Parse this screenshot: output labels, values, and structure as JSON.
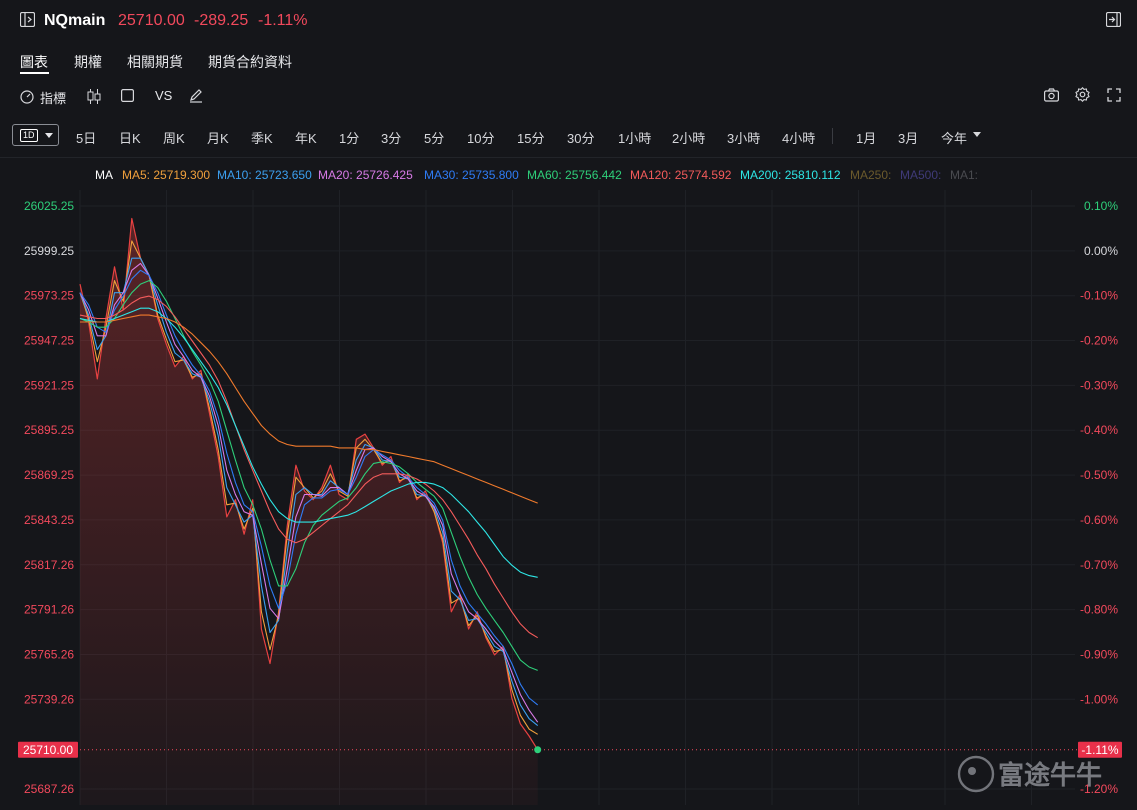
{
  "header": {
    "symbol": "NQmain",
    "price": "25710.00",
    "change": "-289.25",
    "change_pct": "-1.11%"
  },
  "tabs": [
    {
      "label": "圖表",
      "active": true
    },
    {
      "label": "期權"
    },
    {
      "label": "相關期貨"
    },
    {
      "label": "期貨合約資料"
    }
  ],
  "toolbar": {
    "indicators_label": "指標",
    "vs_label": "VS"
  },
  "timeframes": {
    "selected": "1D",
    "items": [
      "5日",
      "日K",
      "周K",
      "月K",
      "季K",
      "年K",
      "1分",
      "3分",
      "5分",
      "10分",
      "15分",
      "30分",
      "1小時",
      "2小時",
      "3小時",
      "4小時"
    ],
    "range_items": [
      "1月",
      "3月",
      "今年"
    ]
  },
  "legend": {
    "title": "MA",
    "items": [
      {
        "text": "MA5: 25719.300",
        "color": "#f0a03c"
      },
      {
        "text": "MA10: 25723.650",
        "color": "#3ca0f0"
      },
      {
        "text": "MA20: 25726.425",
        "color": "#d77ae6"
      },
      {
        "text": "MA30: 25735.800",
        "color": "#2f7cf6"
      },
      {
        "text": "MA60: 25756.442",
        "color": "#2ecf7a"
      },
      {
        "text": "MA120: 25774.592",
        "color": "#f45b5b"
      },
      {
        "text": "MA200: 25810.112",
        "color": "#2ee6e6"
      },
      {
        "text": "MA250:",
        "color": "#6b5a2c"
      },
      {
        "text": "MA500:",
        "color": "#3f3a78"
      },
      {
        "text": "MA1:",
        "color": "#4a4b50"
      }
    ]
  },
  "colors": {
    "price_line": "#e84141",
    "up": "#2ecf7a",
    "down": "#f2495c",
    "grid": "#1f2126"
  },
  "watermark": {
    "logo": "moomoo-logo",
    "text": "富途牛牛"
  },
  "chart_data": {
    "type": "line",
    "ylim": [
      25687.26,
      26025.25
    ],
    "y_ticks_left": [
      {
        "label": "26025.25",
        "value": 26025.25,
        "color": "#2ecf7a"
      },
      {
        "label": "25999.25",
        "value": 25999.25,
        "color": "#d7d8dc"
      },
      {
        "label": "25973.25",
        "value": 25973.25,
        "color": "#f2495c"
      },
      {
        "label": "25947.25",
        "value": 25947.25,
        "color": "#f2495c"
      },
      {
        "label": "25921.25",
        "value": 25921.25,
        "color": "#f2495c"
      },
      {
        "label": "25895.25",
        "value": 25895.25,
        "color": "#f2495c"
      },
      {
        "label": "25869.25",
        "value": 25869.25,
        "color": "#f2495c"
      },
      {
        "label": "25843.25",
        "value": 25843.25,
        "color": "#f2495c"
      },
      {
        "label": "25817.26",
        "value": 25817.26,
        "color": "#f2495c"
      },
      {
        "label": "25791.26",
        "value": 25791.26,
        "color": "#f2495c"
      },
      {
        "label": "25765.26",
        "value": 25765.26,
        "color": "#f2495c"
      },
      {
        "label": "25739.26",
        "value": 25739.26,
        "color": "#f2495c"
      },
      {
        "label": "25687.26",
        "value": 25687.26,
        "color": "#f2495c"
      }
    ],
    "y_ticks_right": [
      {
        "label": "0.10%",
        "value": 26025.25,
        "color": "#2ecf7a"
      },
      {
        "label": "0.00%",
        "value": 25999.25,
        "color": "#d7d8dc"
      },
      {
        "label": "-0.10%",
        "value": 25973.25,
        "color": "#f2495c"
      },
      {
        "label": "-0.20%",
        "value": 25947.25,
        "color": "#f2495c"
      },
      {
        "label": "-0.30%",
        "value": 25921.25,
        "color": "#f2495c"
      },
      {
        "label": "-0.40%",
        "value": 25895.25,
        "color": "#f2495c"
      },
      {
        "label": "-0.50%",
        "value": 25869.25,
        "color": "#f2495c"
      },
      {
        "label": "-0.60%",
        "value": 25843.25,
        "color": "#f2495c"
      },
      {
        "label": "-0.70%",
        "value": 25817.26,
        "color": "#f2495c"
      },
      {
        "label": "-0.80%",
        "value": 25791.26,
        "color": "#f2495c"
      },
      {
        "label": "-0.90%",
        "value": 25765.26,
        "color": "#f2495c"
      },
      {
        "label": "-1.00%",
        "value": 25739.26,
        "color": "#f2495c"
      },
      {
        "label": "-1.20%",
        "value": 25687.26,
        "color": "#f2495c"
      }
    ],
    "last_price": {
      "label": "25710.00",
      "pct_label": "-1.11%",
      "value": 25710.0
    },
    "session_fraction": 0.46,
    "series": [
      {
        "name": "Price",
        "color": "#e84141",
        "width": 1.2,
        "values": [
          25980,
          25958,
          25925,
          25960,
          25990,
          25965,
          26018,
          25995,
          25985,
          25960,
          25945,
          25932,
          25938,
          25925,
          25930,
          25905,
          25880,
          25845,
          25855,
          25835,
          25855,
          25780,
          25760,
          25790,
          25840,
          25875,
          25860,
          25855,
          25862,
          25875,
          25858,
          25855,
          25890,
          25893,
          25885,
          25875,
          25880,
          25865,
          25870,
          25855,
          25860,
          25848,
          25830,
          25790,
          25800,
          25780,
          25790,
          25775,
          25765,
          25770,
          25740,
          25725,
          25718,
          25710
        ]
      },
      {
        "name": "MA5",
        "color": "#f0a03c",
        "width": 1.1,
        "values": [
          25975,
          25960,
          25935,
          25955,
          25982,
          25970,
          26005,
          25995,
          25985,
          25962,
          25948,
          25935,
          25936,
          25926,
          25928,
          25908,
          25884,
          25852,
          25853,
          25838,
          25850,
          25790,
          25768,
          25788,
          25835,
          25868,
          25862,
          25856,
          25860,
          25870,
          25860,
          25857,
          25885,
          25890,
          25884,
          25876,
          25878,
          25866,
          25868,
          25856,
          25858,
          25848,
          25832,
          25795,
          25798,
          25782,
          25788,
          25776,
          25767,
          25768,
          25745,
          25730,
          25722,
          25719
        ]
      },
      {
        "name": "MA10",
        "color": "#3ca0f0",
        "width": 1.1,
        "values": [
          25975,
          25962,
          25942,
          25950,
          25975,
          25975,
          25995,
          25995,
          25985,
          25968,
          25952,
          25940,
          25936,
          25928,
          25926,
          25912,
          25892,
          25862,
          25852,
          25842,
          25846,
          25805,
          25778,
          25785,
          25825,
          25858,
          25862,
          25858,
          25858,
          25866,
          25862,
          25858,
          25878,
          25887,
          25885,
          25878,
          25877,
          25868,
          25867,
          25858,
          25857,
          25850,
          25836,
          25802,
          25797,
          25785,
          25786,
          25778,
          25770,
          25767,
          25750,
          25736,
          25728,
          25724
        ]
      },
      {
        "name": "MA20",
        "color": "#d77ae6",
        "width": 1.1,
        "values": [
          25975,
          25965,
          25950,
          25950,
          25968,
          25975,
          25988,
          25992,
          25985,
          25972,
          25958,
          25945,
          25938,
          25930,
          25926,
          25915,
          25898,
          25872,
          25858,
          25848,
          25846,
          25818,
          25792,
          25786,
          25815,
          25845,
          25858,
          25858,
          25857,
          25862,
          25862,
          25858,
          25872,
          25884,
          25885,
          25880,
          25877,
          25870,
          25867,
          25860,
          25857,
          25851,
          25840,
          25812,
          25800,
          25790,
          25786,
          25780,
          25773,
          25768,
          25755,
          25742,
          25733,
          25726
        ]
      },
      {
        "name": "MA30",
        "color": "#2f7cf6",
        "width": 1.1,
        "values": [
          25975,
          25968,
          25955,
          25952,
          25965,
          25973,
          25983,
          25988,
          25985,
          25975,
          25962,
          25950,
          25941,
          25933,
          25927,
          25918,
          25903,
          25882,
          25865,
          25852,
          25848,
          25828,
          25805,
          25792,
          25808,
          25835,
          25852,
          25856,
          25856,
          25860,
          25861,
          25858,
          25868,
          25880,
          25884,
          25881,
          25878,
          25872,
          25868,
          25862,
          25858,
          25853,
          25843,
          25820,
          25805,
          25795,
          25789,
          25783,
          25776,
          25770,
          25760,
          25748,
          25740,
          25736
        ]
      },
      {
        "name": "MA60",
        "color": "#2ecf7a",
        "width": 1.1,
        "values": [
          25960,
          25958,
          25955,
          25955,
          25960,
          25968,
          25975,
          25980,
          25982,
          25978,
          25970,
          25960,
          25950,
          25941,
          25933,
          25924,
          25912,
          25895,
          25878,
          25862,
          25852,
          25838,
          25820,
          25805,
          25805,
          25815,
          25830,
          25840,
          25846,
          25850,
          25854,
          25856,
          25862,
          25870,
          25876,
          25877,
          25876,
          25874,
          25870,
          25865,
          25861,
          25857,
          25850,
          25836,
          25822,
          25810,
          25800,
          25792,
          25785,
          25778,
          25770,
          25762,
          25758,
          25756
        ]
      },
      {
        "name": "MA120",
        "color": "#f45b5b",
        "width": 1.1,
        "values": [
          25962,
          25961,
          25960,
          25960,
          25962,
          25965,
          25969,
          25972,
          25973,
          25971,
          25967,
          25961,
          25954,
          25947,
          25940,
          25933,
          25924,
          25912,
          25898,
          25884,
          25872,
          25860,
          25848,
          25838,
          25832,
          25830,
          25832,
          25836,
          25840,
          25844,
          25848,
          25852,
          25858,
          25864,
          25868,
          25870,
          25870,
          25870,
          25869,
          25867,
          25864,
          25860,
          25855,
          25848,
          25840,
          25832,
          25823,
          25815,
          25806,
          25798,
          25790,
          25783,
          25778,
          25775
        ]
      },
      {
        "name": "MA200",
        "color": "#2ee6e6",
        "width": 1.1,
        "values": [
          25960,
          25959,
          25958,
          25958,
          25960,
          25962,
          25964,
          25966,
          25966,
          25964,
          25960,
          25955,
          25949,
          25942,
          25935,
          25928,
          25920,
          25910,
          25898,
          25886,
          25874,
          25864,
          25855,
          25848,
          25844,
          25842,
          25842,
          25842,
          25843,
          25844,
          25845,
          25846,
          25848,
          25851,
          25854,
          25857,
          25860,
          25862,
          25864,
          25865,
          25865,
          25864,
          25862,
          25858,
          25853,
          25848,
          25842,
          25836,
          25829,
          25822,
          25817,
          25813,
          25811,
          25810
        ]
      },
      {
        "name": "MA250",
        "color": "#f07a2c",
        "width": 1.1,
        "values": [
          25958,
          25958,
          25958,
          25958,
          25959,
          25960,
          25961,
          25962,
          25962,
          25961,
          25960,
          25958,
          25955,
          25951,
          25946,
          25941,
          25935,
          25928,
          25920,
          25912,
          25905,
          25898,
          25893,
          25889,
          25887,
          25886,
          25886,
          25886,
          25886,
          25886,
          25885,
          25885,
          25885,
          25884,
          25884,
          25883,
          25882,
          25881,
          25880,
          25879,
          25878,
          25877,
          25875,
          25873,
          25871,
          25869,
          25867,
          25865,
          25863,
          25861,
          25859,
          25857,
          25855,
          25853
        ]
      }
    ]
  }
}
